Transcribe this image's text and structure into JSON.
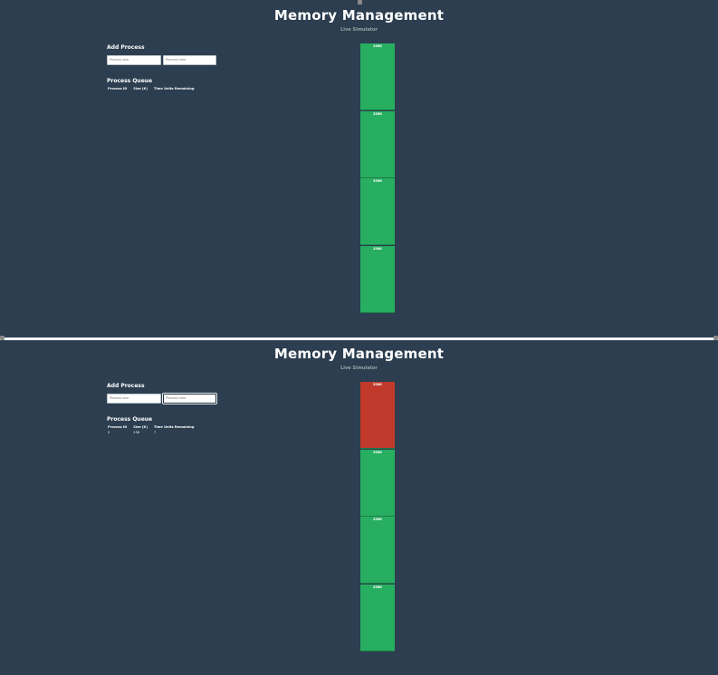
{
  "screens": [
    {
      "title": "Memory Management",
      "subtitle": "Live Simulator",
      "add_process": {
        "heading": "Add Process",
        "size_placeholder": "Process size",
        "time_placeholder": "Process time"
      },
      "queue": {
        "heading": "Process Queue",
        "columns": [
          "Process ID",
          "Size (K)",
          "Time Units Remaining"
        ],
        "rows": []
      },
      "memory_blocks": [
        {
          "label": "256K",
          "status": "free"
        },
        {
          "label": "256K",
          "status": "free"
        },
        {
          "label": "256K",
          "status": "free"
        },
        {
          "label": "256K",
          "status": "free"
        }
      ]
    },
    {
      "title": "Memory Management",
      "subtitle": "Live Simulator",
      "add_process": {
        "heading": "Add Process",
        "size_placeholder": "Process size",
        "time_placeholder": "Process time"
      },
      "queue": {
        "heading": "Process Queue",
        "columns": [
          "Process ID",
          "Size (K)",
          "Time Units Remaining"
        ],
        "rows": [
          [
            "0",
            "256",
            "7"
          ]
        ]
      },
      "memory_blocks": [
        {
          "label": "256K",
          "status": "used"
        },
        {
          "label": "256K",
          "status": "free"
        },
        {
          "label": "256K",
          "status": "free"
        },
        {
          "label": "256K",
          "status": "free"
        }
      ]
    }
  ],
  "colors": {
    "background": "#2c3e50",
    "free_block": "#27ae60",
    "used_block": "#c0392b"
  }
}
